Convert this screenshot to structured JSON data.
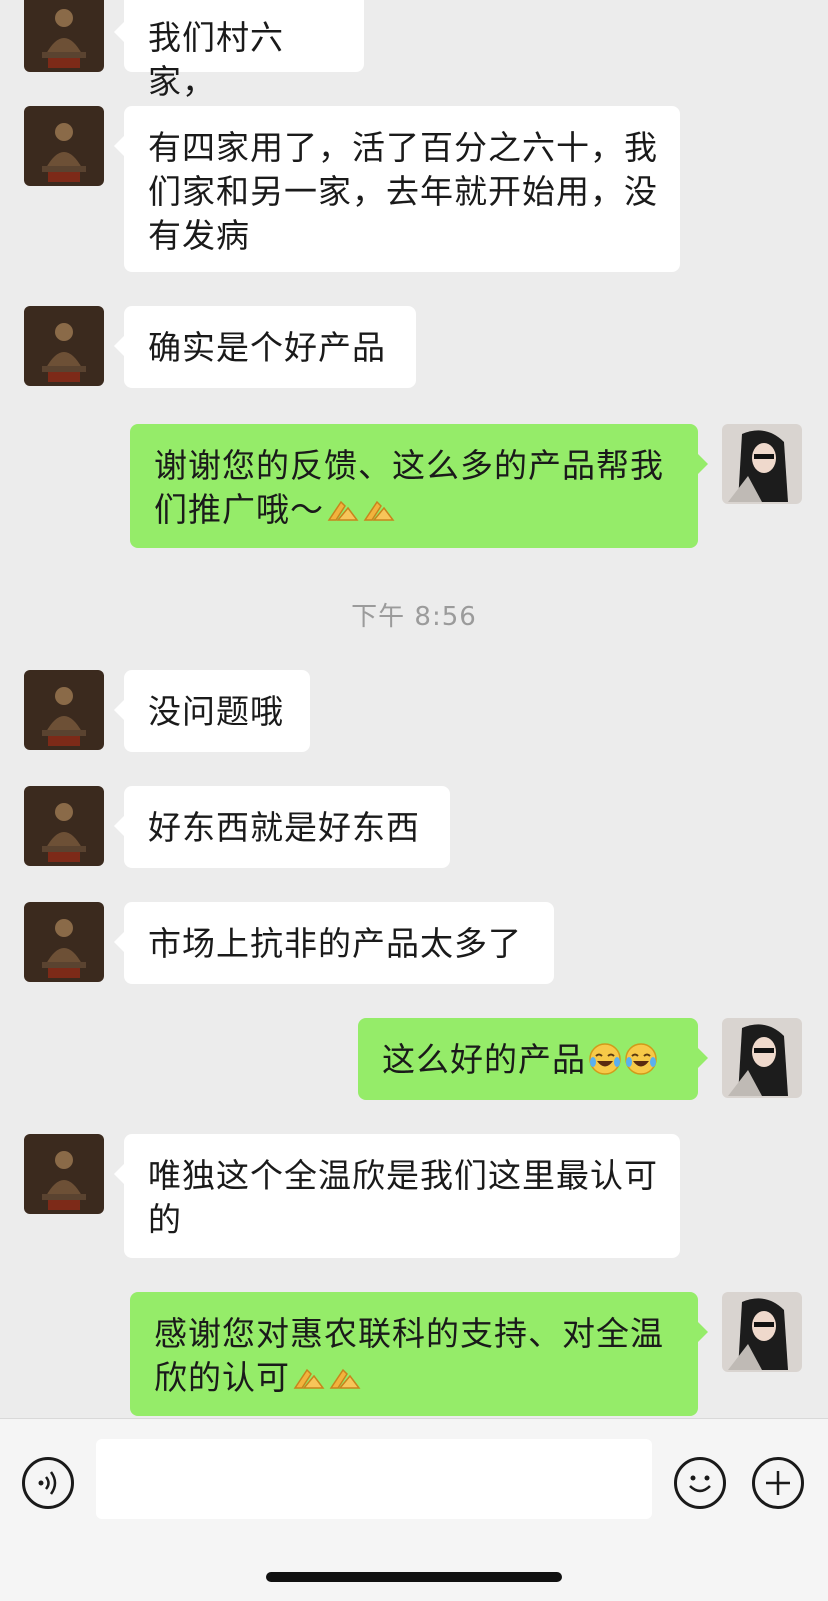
{
  "messages": [
    {
      "side": "in",
      "text": "我们村六家，"
    },
    {
      "side": "in",
      "text": "有四家用了，活了百分之六十，我们家和另一家，去年就开始用，没有发病"
    },
    {
      "side": "in",
      "text": "确实是个好产品"
    },
    {
      "side": "out",
      "text": "谢谢您的反馈、这么多的产品帮我们推广哦～",
      "emoji": [
        "bow-hands",
        "bow-hands"
      ]
    },
    {
      "side": "in",
      "text": "没问题哦"
    },
    {
      "side": "in",
      "text": "好东西就是好东西"
    },
    {
      "side": "in",
      "text": "市场上抗非的产品太多了"
    },
    {
      "side": "out",
      "text": "这么好的产品",
      "emoji": [
        "tears-of-joy",
        "tears-of-joy"
      ]
    },
    {
      "side": "in",
      "text": "唯独这个全温欣是我们这里最认可的"
    },
    {
      "side": "out",
      "text": "感谢您对惠农联科的支持、对全温欣的认可",
      "emoji": [
        "bow-hands",
        "bow-hands"
      ]
    }
  ],
  "timestamp": "下午 8:56",
  "input": {
    "placeholder": ""
  },
  "icons": {
    "voice": "voice-icon",
    "emoji": "smiley-icon",
    "plus": "plus-icon"
  },
  "colors": {
    "background": "#ececec",
    "incoming_bubble": "#ffffff",
    "outgoing_bubble": "#95ec69"
  }
}
